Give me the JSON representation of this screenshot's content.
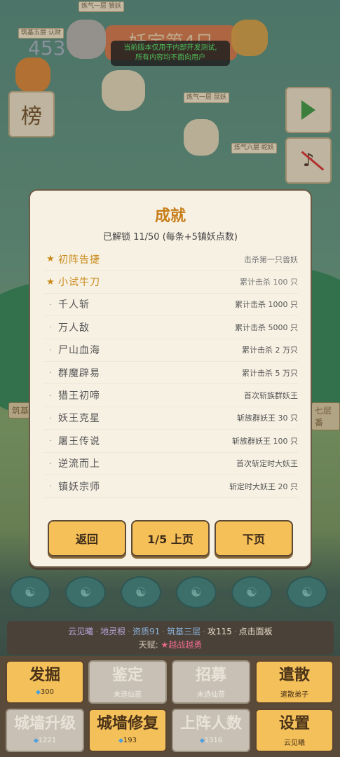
{
  "background": {
    "score": "453",
    "title_banner": "妖定第4日",
    "dev_notice": [
      "当前版本仅用于内部开发测试,",
      "所有内容均不面向用户"
    ],
    "leaderboard_label": "榜",
    "sprite_labels": [
      "筑基五层 认财",
      "炼气一层 狼妖",
      "炼气一层 鼠妖",
      "炼气六层 蛇妖"
    ],
    "wall_labels": [
      "筑基 江",
      "七层 番"
    ]
  },
  "modal": {
    "title": "成就",
    "subtitle": "已解锁 11/50 (每条+5镇妖点数)",
    "achievements": [
      {
        "mark": "★",
        "name": "初阵告捷",
        "desc": "击杀第一只兽妖",
        "unlocked": true
      },
      {
        "mark": "★",
        "name": "小试牛刀",
        "desc": "累计击杀 100 只",
        "unlocked": true
      },
      {
        "mark": "·",
        "name": "千人斩",
        "desc": "累计击杀 1000 只",
        "unlocked": false
      },
      {
        "mark": "·",
        "name": "万人敌",
        "desc": "累计击杀 5000 只",
        "unlocked": false
      },
      {
        "mark": "·",
        "name": "尸山血海",
        "desc": "累计击杀 2 万只",
        "unlocked": false
      },
      {
        "mark": "·",
        "name": "群魔辟易",
        "desc": "累计击杀 5 万只",
        "unlocked": false
      },
      {
        "mark": "·",
        "name": "猎王初啼",
        "desc": "首次斩族群妖王",
        "unlocked": false
      },
      {
        "mark": "·",
        "name": "妖王克星",
        "desc": "斩族群妖王 30 只",
        "unlocked": false
      },
      {
        "mark": "·",
        "name": "屠王传说",
        "desc": "斩族群妖王 100 只",
        "unlocked": false
      },
      {
        "mark": "·",
        "name": "逆流而上",
        "desc": "首次斩定时大妖王",
        "unlocked": false
      },
      {
        "mark": "·",
        "name": "镇妖宗师",
        "desc": "斩定时大妖王 20 只",
        "unlocked": false
      }
    ],
    "buttons": {
      "back": "返回",
      "prev": "1/5 上页",
      "next": "下页"
    }
  },
  "info_bar": {
    "name": "云见曦",
    "root": "地灵根",
    "aptitude": "资质91",
    "realm": "筑基三层",
    "attack": "攻115",
    "hint": "点击面板",
    "sep": "·",
    "talent_label": "天赋: ",
    "talent_value": "★越战越勇"
  },
  "actions": [
    {
      "label": "发掘",
      "sub": "300",
      "cost": true,
      "enabled": true
    },
    {
      "label": "鉴定",
      "sub": "未选仙苗",
      "cost": false,
      "enabled": false
    },
    {
      "label": "招募",
      "sub": "未选仙苗",
      "cost": false,
      "enabled": false
    },
    {
      "label": "遣散",
      "sub": "遣散弟子",
      "cost": false,
      "enabled": true
    },
    {
      "label": "城墙升级",
      "sub": "1221",
      "cost": true,
      "enabled": false
    },
    {
      "label": "城墙修复",
      "sub": "193",
      "cost": true,
      "enabled": true
    },
    {
      "label": "上阵人数",
      "sub": "1316",
      "cost": true,
      "enabled": false
    },
    {
      "label": "设置",
      "sub": "云见曦",
      "cost": false,
      "enabled": true
    }
  ],
  "colors": {
    "accent_gold": "#c77d17",
    "button_fill": "#f6c058",
    "panel_bg": "#f7f1e4"
  }
}
